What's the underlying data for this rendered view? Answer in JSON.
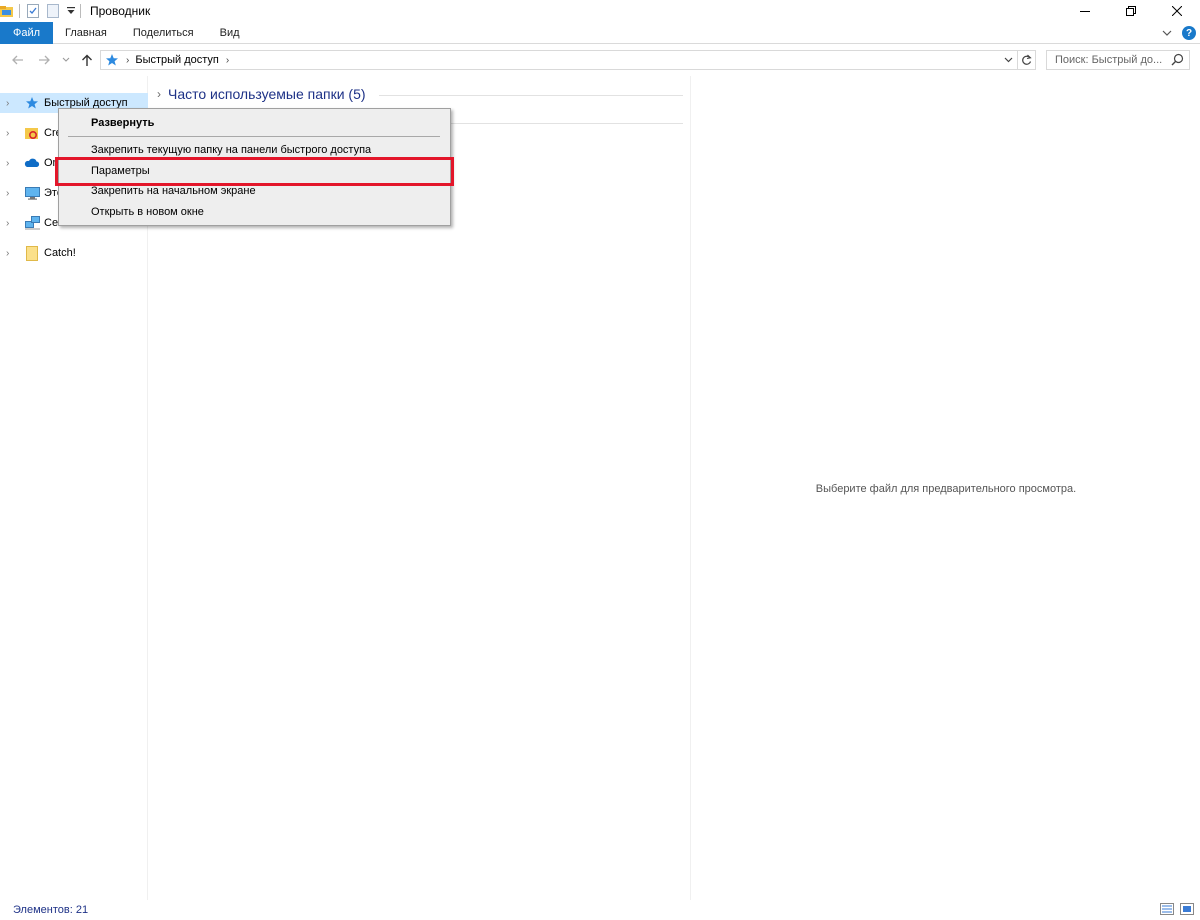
{
  "window": {
    "title": "Проводник",
    "controls": [
      "minimize",
      "restore",
      "close"
    ]
  },
  "ribbon": {
    "tabs": [
      {
        "label": "Файл",
        "active": true
      },
      {
        "label": "Главная"
      },
      {
        "label": "Поделиться"
      },
      {
        "label": "Вид"
      }
    ],
    "help_label": "?"
  },
  "address": {
    "breadcrumb": [
      "Быстрый доступ"
    ],
    "search_placeholder": "Поиск: Быстрый до..."
  },
  "nav": {
    "items": [
      {
        "label": "Быстрый доступ",
        "icon": "star-icon",
        "selected": true
      },
      {
        "label": "Cre",
        "icon": "creative-cloud-icon"
      },
      {
        "label": "On",
        "icon": "onedrive-icon"
      },
      {
        "label": "Это",
        "icon": "this-pc-icon"
      },
      {
        "label": "Сет",
        "icon": "network-icon"
      },
      {
        "label": "Catch!",
        "icon": "folder-icon"
      }
    ]
  },
  "content": {
    "group_title": "Часто используемые папки (5)"
  },
  "preview": {
    "text": "Выберите файл для предварительного просмотра."
  },
  "context_menu": {
    "items": [
      {
        "label": "Развернуть",
        "bold": true
      },
      {
        "label": "Закрепить текущую папку на панели быстрого доступа"
      },
      {
        "label": "Параметры",
        "highlighted": true
      },
      {
        "label": "Закрепить на начальном экране"
      },
      {
        "label": "Открыть в новом окне"
      }
    ]
  },
  "status": {
    "items_text": "Элементов: 21"
  },
  "colors": {
    "accent": "#1979ca",
    "highlight_box": "#e3162a",
    "nav_selected": "#cce8ff",
    "group_title": "#1e3287"
  }
}
